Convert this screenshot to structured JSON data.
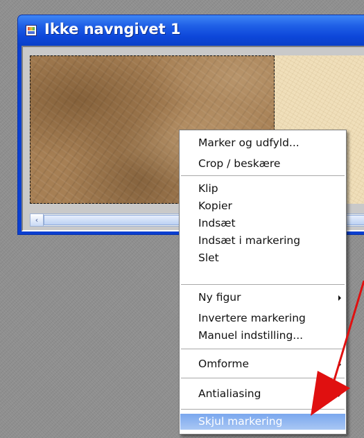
{
  "window": {
    "title": "Ikke navngivet 1"
  },
  "scrollbar": {
    "left_arrow": "‹"
  },
  "context_menu": {
    "items": [
      {
        "label": "Marker og udfyld...",
        "submenu": false,
        "highlighted": false
      },
      {
        "label": "Crop / beskære",
        "submenu": false,
        "highlighted": false
      },
      {
        "label": "Klip",
        "submenu": false,
        "highlighted": false
      },
      {
        "label": "Kopier",
        "submenu": false,
        "highlighted": false
      },
      {
        "label": "Indsæt",
        "submenu": false,
        "highlighted": false
      },
      {
        "label": "Indsæt i markering",
        "submenu": false,
        "highlighted": false
      },
      {
        "label": "Slet",
        "submenu": false,
        "highlighted": false
      },
      {
        "label": "Ny figur",
        "submenu": true,
        "highlighted": false
      },
      {
        "label": "Invertere markering",
        "submenu": false,
        "highlighted": false
      },
      {
        "label": "Manuel indstilling...",
        "submenu": false,
        "highlighted": false
      },
      {
        "label": "Omforme",
        "submenu": true,
        "highlighted": false
      },
      {
        "label": "Antialiasing",
        "submenu": true,
        "highlighted": false
      },
      {
        "label": "Skjul markering",
        "submenu": false,
        "highlighted": true
      }
    ]
  },
  "colors": {
    "title_bar": "#0d47da",
    "menu_highlight": "#8fb4f0",
    "annotation_arrow": "#e01010"
  }
}
